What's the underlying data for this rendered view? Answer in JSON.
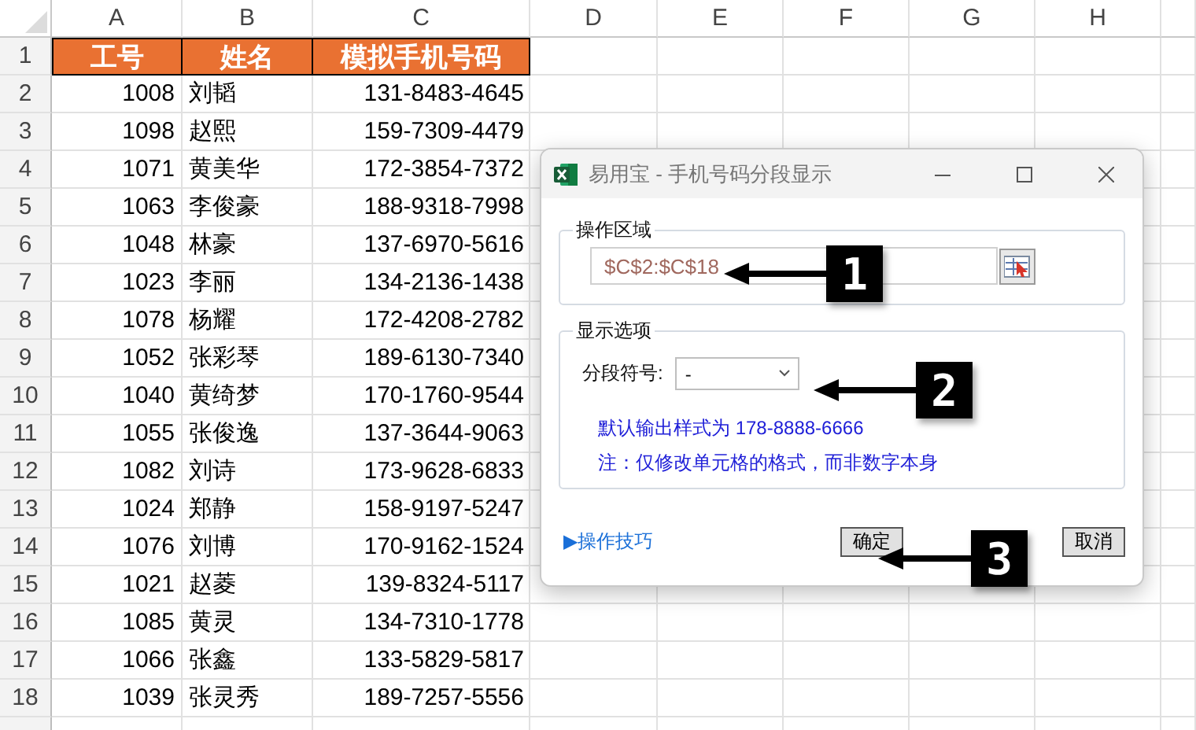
{
  "sheet": {
    "columns": [
      "A",
      "B",
      "C",
      "D",
      "E",
      "F",
      "G",
      "H"
    ],
    "header_row": {
      "number": "1",
      "cells": [
        "工号",
        "姓名",
        "模拟手机号码"
      ]
    },
    "rows": [
      {
        "number": "2",
        "cells": [
          "1008",
          "刘韬",
          "131-8483-4645"
        ]
      },
      {
        "number": "3",
        "cells": [
          "1098",
          "赵熙",
          "159-7309-4479"
        ]
      },
      {
        "number": "4",
        "cells": [
          "1071",
          "黄美华",
          "172-3854-7372"
        ]
      },
      {
        "number": "5",
        "cells": [
          "1063",
          "李俊豪",
          "188-9318-7998"
        ]
      },
      {
        "number": "6",
        "cells": [
          "1048",
          "林豪",
          "137-6970-5616"
        ]
      },
      {
        "number": "7",
        "cells": [
          "1023",
          "李丽",
          "134-2136-1438"
        ]
      },
      {
        "number": "8",
        "cells": [
          "1078",
          "杨耀",
          "172-4208-2782"
        ]
      },
      {
        "number": "9",
        "cells": [
          "1052",
          "张彩琴",
          "189-6130-7340"
        ]
      },
      {
        "number": "10",
        "cells": [
          "1040",
          "黄绮梦",
          "170-1760-9544"
        ]
      },
      {
        "number": "11",
        "cells": [
          "1055",
          "张俊逸",
          "137-3644-9063"
        ]
      },
      {
        "number": "12",
        "cells": [
          "1082",
          "刘诗",
          "173-9628-6833"
        ]
      },
      {
        "number": "13",
        "cells": [
          "1024",
          "郑静",
          "158-9197-5247"
        ]
      },
      {
        "number": "14",
        "cells": [
          "1076",
          "刘博",
          "170-9162-1524"
        ]
      },
      {
        "number": "15",
        "cells": [
          "1021",
          "赵菱",
          "139-8324-5117"
        ]
      },
      {
        "number": "16",
        "cells": [
          "1085",
          "黄灵",
          "134-7310-1778"
        ]
      },
      {
        "number": "17",
        "cells": [
          "1066",
          "张鑫",
          "133-5829-5817"
        ]
      },
      {
        "number": "18",
        "cells": [
          "1039",
          "张灵秀",
          "189-7257-5556"
        ]
      }
    ]
  },
  "dialog": {
    "title": "易用宝 - 手机号码分段显示",
    "range_group": {
      "label": "操作区域",
      "value": "$C$2:$C$18"
    },
    "options_group": {
      "label": "显示选项",
      "separator_label": "分段符号:",
      "separator_value": "-",
      "notes": [
        "默认输出样式为 178-8888-6666",
        "注：仅修改单元格的格式，而非数字本身"
      ]
    },
    "tips_link": "▶操作技巧",
    "buttons": [
      "确定",
      "取消"
    ]
  },
  "callouts": [
    "1",
    "2",
    "3"
  ]
}
